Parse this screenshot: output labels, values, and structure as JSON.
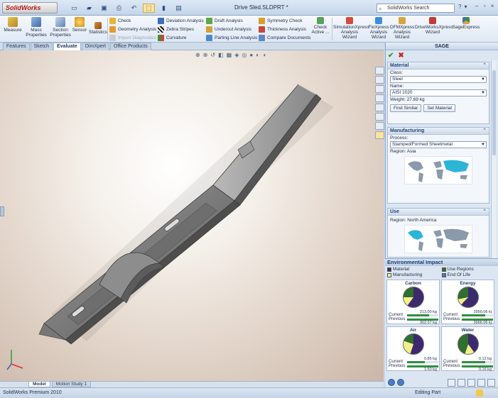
{
  "app": {
    "logo": "SolidWorks",
    "document_title": "Drive Sled.SLDPRT *",
    "search_placeholder": "SolidWorks Search"
  },
  "command_manager": {
    "big_buttons": [
      {
        "label": "Measure"
      },
      {
        "label": "Mass Properties"
      },
      {
        "label": "Section Properties"
      },
      {
        "label": "Sensor"
      },
      {
        "label": "Statistics"
      }
    ],
    "col1": [
      "Check",
      "Geometry Analysis",
      "Import Diagnostics"
    ],
    "col2": [
      "Deviation Analysis",
      "Zebra Stripes",
      "Curvature"
    ],
    "col3": [
      "Draft Analysis",
      "Undercut Analysis",
      "Parting Line Analysis"
    ],
    "col4": [
      "Symmetry Check",
      "Thickness Analysis",
      "Compare Documents"
    ],
    "check_active": "Check Active ...",
    "wizards": [
      "SimulationXpress Analysis Wizard",
      "FloXpress Analysis Wizard",
      "DFMXpress Analysis Wizard",
      "DriveWorksXpress Wizard",
      "SageExpress"
    ]
  },
  "tabs": [
    "Features",
    "Sketch",
    "Evaluate",
    "DimXpert",
    "Office Products"
  ],
  "active_tab": "Evaluate",
  "bottom_tabs": [
    "Model",
    "Motion Study 1"
  ],
  "status": {
    "left": "SolidWorks Premium 2010",
    "right": "Editing Part"
  },
  "sage_pane": {
    "title": "SAGE",
    "material": {
      "header": "Material",
      "class_label": "Class:",
      "class_value": "Steel",
      "name_label": "Name:",
      "name_value": "AISI 1020",
      "weight": "Weight: 27.69 kg",
      "find_similar": "Find Similar",
      "set_material": "Set Material"
    },
    "manufacturing": {
      "header": "Manufacturing",
      "process_label": "Process:",
      "process_value": "Stamped/Formed Sheetmetal",
      "region_label": "Region:",
      "region_value": "Asia"
    },
    "use": {
      "header": "Use",
      "region_label": "Region:",
      "region_value": "North America"
    }
  },
  "environmental": {
    "header": "Environmental Impact",
    "legend": [
      "Material",
      "Use Regions",
      "Manufacturing",
      "End Of Life"
    ],
    "legend_colors": [
      "#3b2a6e",
      "#2f6f2f",
      "#f3f08a",
      "#4a78b5"
    ],
    "current_label": "Current",
    "previous_label": "Previous",
    "cards": [
      {
        "title": "Carbon",
        "current": "213.00 kg",
        "previous": "302.07 kg",
        "current_pct": 70
      },
      {
        "title": "Energy",
        "current": "2950.06 kj",
        "previous": "3966.06 kj",
        "current_pct": 74
      },
      {
        "title": "Air",
        "current": "0.85 kg",
        "previous": "1.50 kg",
        "current_pct": 57
      },
      {
        "title": "Water",
        "current": "0.12 kg",
        "previous": "0.16 kg",
        "current_pct": 75
      }
    ]
  }
}
